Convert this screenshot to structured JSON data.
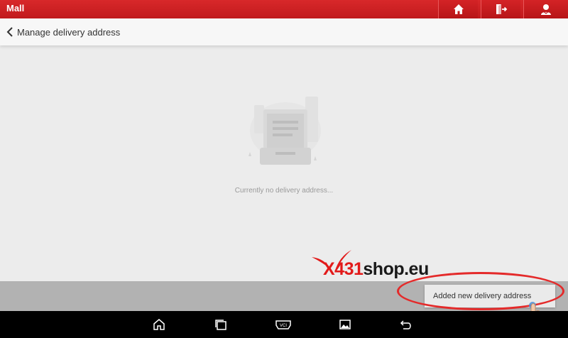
{
  "titlebar": {
    "app_title": "Mall",
    "icons": [
      "home-icon",
      "exit-icon",
      "user-icon"
    ]
  },
  "header": {
    "back_icon": "chevron-left-icon",
    "title": "Manage delivery address"
  },
  "empty_state": {
    "illustration": "empty-document-icon",
    "message": "Currently no delivery address..."
  },
  "toast": {
    "text": "Added new delivery address"
  },
  "watermark": {
    "red_part": "X431",
    "black_part": "shop.eu"
  },
  "navbar": {
    "icons": [
      "home-icon",
      "recent-apps-icon",
      "vci-icon",
      "gallery-icon",
      "back-icon"
    ],
    "vci_label": "VCI"
  },
  "colors": {
    "titlebar": "#c8201f",
    "highlight": "#e42a2a",
    "background": "#ececec"
  }
}
